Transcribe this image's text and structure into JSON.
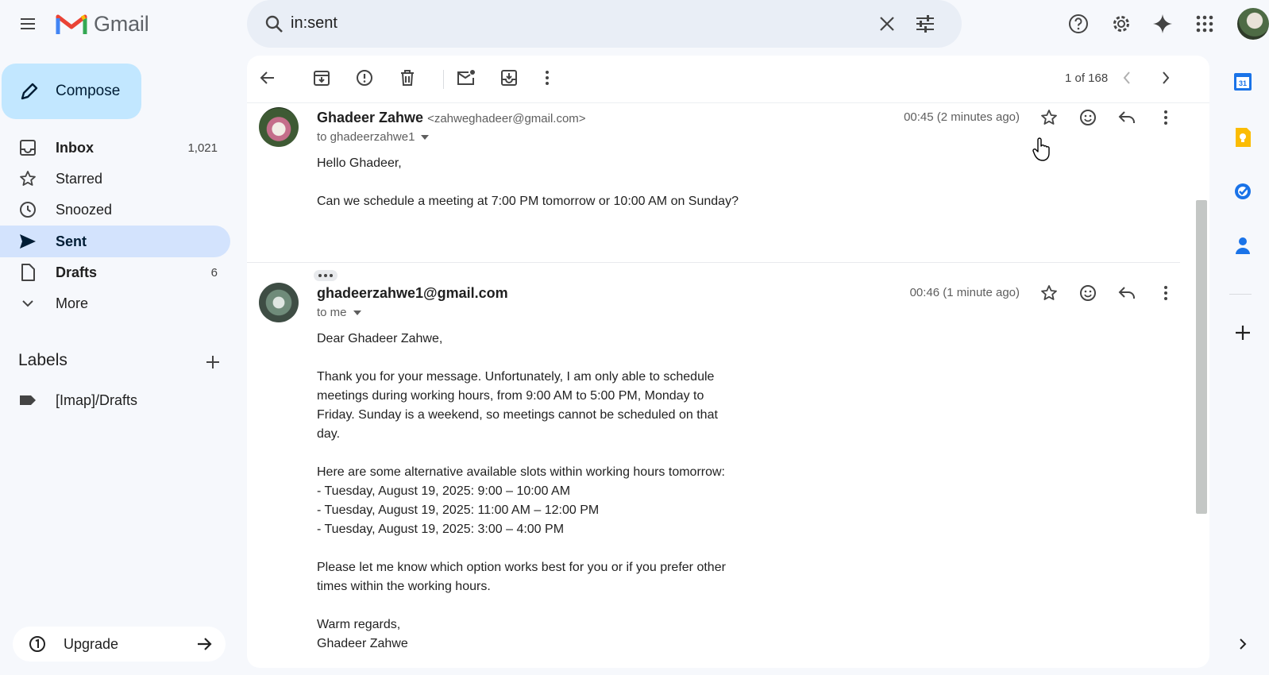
{
  "app": {
    "name": "Gmail"
  },
  "search": {
    "query": "in:sent"
  },
  "compose": {
    "label": "Compose"
  },
  "nav": [
    {
      "label": "Inbox",
      "count": "1,021"
    },
    {
      "label": "Starred",
      "count": ""
    },
    {
      "label": "Snoozed",
      "count": ""
    },
    {
      "label": "Sent",
      "count": ""
    },
    {
      "label": "Drafts",
      "count": "6"
    },
    {
      "label": "More",
      "count": ""
    }
  ],
  "labels": {
    "heading": "Labels",
    "items": [
      {
        "label": "[Imap]/Drafts"
      }
    ]
  },
  "upgrade": {
    "label": "Upgrade"
  },
  "toolbar": {
    "pager": "1 of 168"
  },
  "messages": [
    {
      "sender_name": "Ghadeer Zahwe",
      "sender_email": "<zahweghadeer@gmail.com>",
      "to": "to ghadeerzahwe1",
      "time": "00:45 (2 minutes ago)",
      "body": "Hello Ghadeer,\n\nCan we schedule a meeting at 7:00 PM tomorrow or 10:00 AM on Sunday?"
    },
    {
      "sender_name": "ghadeerzahwe1@gmail.com",
      "sender_email": "",
      "to": "to me",
      "time": "00:46 (1 minute ago)",
      "body": "Dear Ghadeer Zahwe,\n\nThank you for your message. Unfortunately, I am only able to schedule meetings during working hours, from 9:00 AM to 5:00 PM, Monday to Friday. Sunday is a weekend, so meetings cannot be scheduled on that day.\n\nHere are some alternative available slots within working hours tomorrow:\n- Tuesday, August 19, 2025: 9:00 – 10:00 AM\n- Tuesday, August 19, 2025: 11:00 AM – 12:00 PM\n- Tuesday, August 19, 2025: 3:00 – 4:00 PM\n\nPlease let me know which option works best for you or if you prefer other times within the working hours.\n\nWarm regards,\nGhadeer Zahwe"
    }
  ],
  "rail": {
    "calendar_day": "31"
  },
  "colors": {
    "compose_bg": "#c2e7ff",
    "active_nav": "#d3e3fd",
    "page_bg": "#f6f8fc"
  }
}
